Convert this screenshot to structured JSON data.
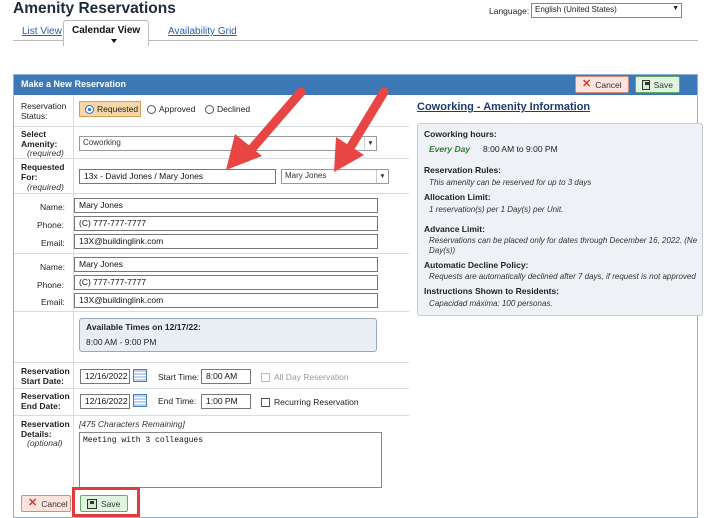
{
  "header": {
    "app_title": "Amenity Reservations",
    "language_label": "Language:",
    "language_value": "English (United States)",
    "tabs": [
      {
        "label": "List View"
      },
      {
        "label": "Calendar View"
      },
      {
        "label": "Availability Grid"
      }
    ]
  },
  "panel": {
    "title": "Make a New Reservation",
    "cancel_label": "Cancel",
    "save_label": "Save"
  },
  "form": {
    "status_label": "Reservation Status:",
    "status_options": [
      "Requested",
      "Approved",
      "Declined"
    ],
    "status_selected": "Requested",
    "amenity_label": "Select Amenity:",
    "required_text": "(required)",
    "amenity_value": "Coworking",
    "requested_for_label": "Requested For:",
    "requested_for_value": "13x - David Jones / Mary Jones",
    "requested_for_person": "Mary Jones",
    "contacts": [
      {
        "name": "Mary Jones",
        "phone": "(C) 777-777-7777",
        "email": "13X@buildinglink.com"
      },
      {
        "name": "Mary Jones",
        "phone": "(C) 777-777-7777",
        "email": "13X@buildinglink.com"
      }
    ],
    "name_label": "Name:",
    "phone_label": "Phone:",
    "email_label": "Email:",
    "available_title": "Available Times on 12/17/22:",
    "available_times": "8:00 AM - 9:00 PM",
    "start_date_label": "Reservation Start Date:",
    "start_date": "12/16/2022",
    "start_time_label": "Start Time:",
    "start_time": "8:00 AM",
    "all_day_label": "All Day Reservation",
    "end_date_label": "Reservation End Date:",
    "end_date": "12/16/2022",
    "end_time_label": "End Time:",
    "end_time": "1:00 PM",
    "recurring_label": "Recurring Reservation",
    "details_label": "Reservation Details:",
    "optional_text": "(optional)",
    "chars_remaining": "[475 Characters Remaining]",
    "details_value": "Meeting with 3 colleagues",
    "bottom_cancel_label": "Cancel",
    "bottom_save_label": "Save"
  },
  "info": {
    "title": "Coworking - Amenity Information",
    "hours_heading": "Coworking hours:",
    "hours_day": "Every Day",
    "hours_value": "8:00 AM to 9:00 PM",
    "rules_heading": "Reservation Rules:",
    "rules_text": "This amenity can be reserved for up to 3 days",
    "allocation_heading": "Allocation Limit:",
    "allocation_text": "1 reservation(s) per 1 Day(s) per Unit.",
    "advance_heading": "Advance Limit:",
    "advance_text_1": "Reservations can be placed only for dates through December 16, 2022. (Ne",
    "advance_text_2": "Day(s))",
    "decline_heading": "Automatic Decline Policy:",
    "decline_text": "Requests are automatically declined after 7 days, if request is not approved",
    "instructions_heading": "Instructions Shown to Residents:",
    "instructions_text": "Capacidad máxima: 100 personas."
  },
  "annotations": {
    "arrow_color": "#e84545",
    "highlight_color": "#e23b3b"
  }
}
